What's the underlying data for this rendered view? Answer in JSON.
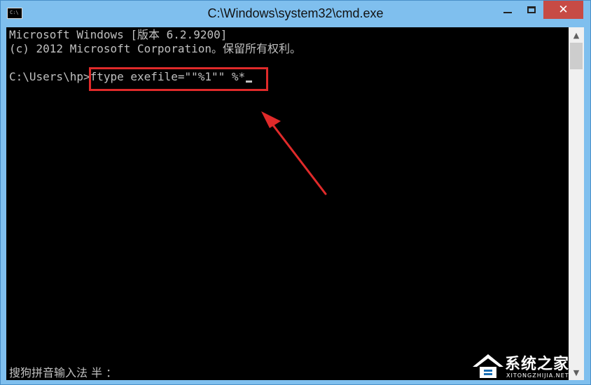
{
  "window": {
    "title": "C:\\Windows\\system32\\cmd.exe",
    "icon": "cmd-icon",
    "icon_text": "C:\\",
    "controls": {
      "minimize": "minimize-icon",
      "maximize": "maximize-icon",
      "close": "✕"
    }
  },
  "console": {
    "lines": [
      "Microsoft Windows [版本 6.2.9200]",
      "(c) 2012 Microsoft Corporation。保留所有权利。",
      "",
      "C:\\Users\\hp>ftype exefile=\"\"%1\"\" %*"
    ],
    "ime_status": "搜狗拼音输入法 半 ："
  },
  "annotation": {
    "highlight_color": "#e02a2a",
    "arrow_color": "#e02a2a"
  },
  "watermark": {
    "text": "系统之家",
    "subtext": "XITONGZHIJIA.NET"
  },
  "colors": {
    "titlebar": "#7fbfee",
    "console_bg": "#000000",
    "console_text": "#c0c0c0",
    "close_button": "#c74b45"
  }
}
